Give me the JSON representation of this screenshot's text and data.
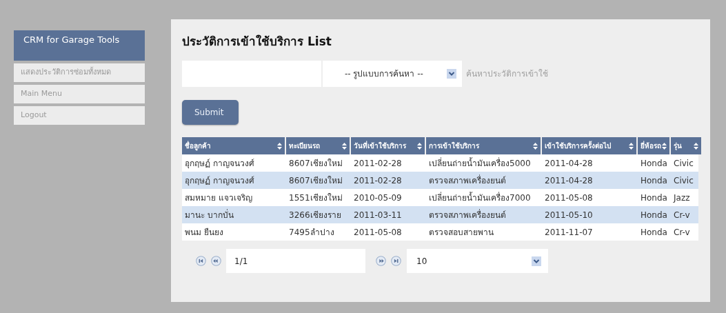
{
  "sidebar": {
    "title": "CRM for Garage Tools",
    "items": [
      {
        "label": "แสดงประวัติการซ่อมทั้งหมด"
      },
      {
        "label": "Main Menu"
      },
      {
        "label": "Logout"
      }
    ]
  },
  "page_title": {
    "thai": "ประวัติการเข้าใช้บริการ",
    "english": "List"
  },
  "search": {
    "select_value": "-- รูปแบบการค้นหา --",
    "hint": "ค้นหาประวัติการเข้าใช้",
    "submit": "Submit"
  },
  "table": {
    "columns": [
      "ชื่อลูกค้า",
      "ทะเบียนรถ",
      "วันที่เข้าใช้บริการ",
      "การเข้าใช้บริการ",
      "เข้าใช้บริการครั้งต่อไป",
      "ยี่ห้อรถ",
      "รุ่น"
    ],
    "rows": [
      {
        "cells": [
          "อุกฤษฏ์ กาญจนวงศ์",
          "8607เชียงใหม่",
          "2011-02-28",
          "เปลี่ยนถ่ายน้ำมันเครื่อง5000",
          "2011-04-28",
          "Honda",
          "Civic"
        ]
      },
      {
        "cells": [
          "อุกฤษฏ์ กาญจนวงศ์",
          "8607เชียงใหม่",
          "2011-02-28",
          "ตรวจสภาพเครื่องยนต์",
          "2011-04-28",
          "Honda",
          "Civic"
        ]
      },
      {
        "cells": [
          "สมหมาย แจวเจริญ",
          "1551เชียงใหม่",
          "2010-05-09",
          "เปลี่ยนถ่ายน้ำมันเครื่อง7000",
          "2011-05-08",
          "Honda",
          "Jazz"
        ]
      },
      {
        "cells": [
          "มานะ บากบั่น",
          "3266เชียงราย",
          "2011-03-11",
          "ตรวจสภาพเครื่องยนต์",
          "2011-05-10",
          "Honda",
          "Cr-v"
        ]
      },
      {
        "cells": [
          "พนม ยืนยง",
          "7495ลำปาง",
          "2011-05-08",
          "ตรวจสอบสายพาน",
          "2011-11-07",
          "Honda",
          "Cr-v"
        ]
      }
    ]
  },
  "pager": {
    "page": "1/1",
    "page_size": "10"
  }
}
